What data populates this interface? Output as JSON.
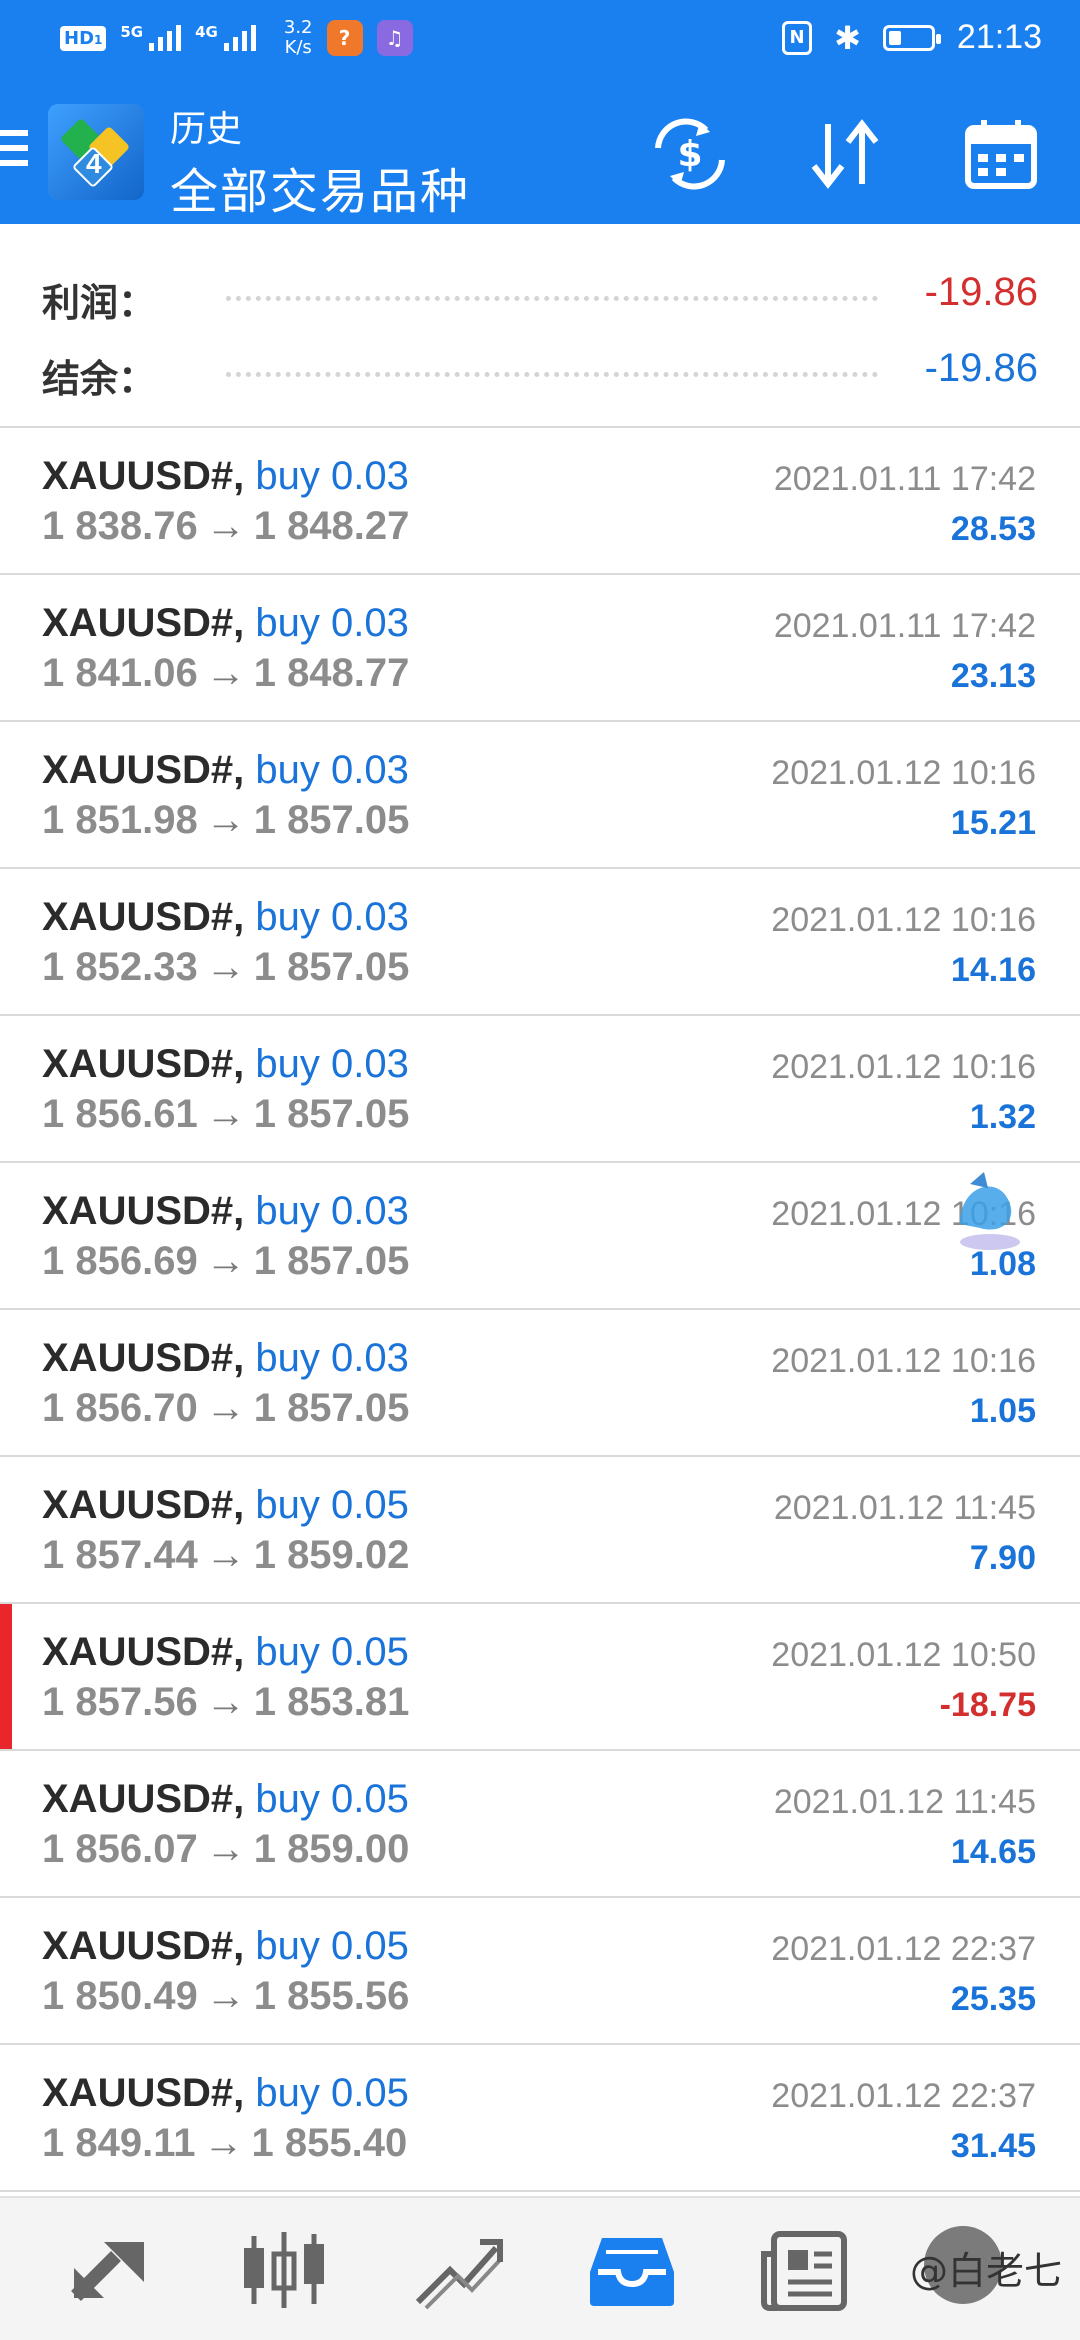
{
  "statusbar": {
    "hd_label": "HD",
    "hd_sub": "1",
    "sig1_label": "5G",
    "sig2_label": "4G",
    "speed_value": "3.2",
    "speed_unit": "K/s",
    "nfc_label": "N",
    "bluetooth_glyph": "✱",
    "battery_level": 0.3,
    "time": "21:13"
  },
  "appbar": {
    "subtitle": "历史",
    "title": "全部交易品种",
    "logo_number": "4"
  },
  "summary": {
    "profit_label": "利润：",
    "profit_value": "-19.86",
    "balance_label": "结余：",
    "balance_value": "-19.86"
  },
  "colors": {
    "accent": "#1a80f0",
    "positive": "#1a73d9",
    "negative": "#d32f2f"
  },
  "trades": [
    {
      "symbol": "XAUUSD#,",
      "action": "buy 0.03",
      "open": "1 838.76",
      "close": "1 848.27",
      "time": "2021.01.11 17:42",
      "profit": "28.53",
      "negative": false
    },
    {
      "symbol": "XAUUSD#,",
      "action": "buy 0.03",
      "open": "1 841.06",
      "close": "1 848.77",
      "time": "2021.01.11 17:42",
      "profit": "23.13",
      "negative": false
    },
    {
      "symbol": "XAUUSD#,",
      "action": "buy 0.03",
      "open": "1 851.98",
      "close": "1 857.05",
      "time": "2021.01.12 10:16",
      "profit": "15.21",
      "negative": false
    },
    {
      "symbol": "XAUUSD#,",
      "action": "buy 0.03",
      "open": "1 852.33",
      "close": "1 857.05",
      "time": "2021.01.12 10:16",
      "profit": "14.16",
      "negative": false
    },
    {
      "symbol": "XAUUSD#,",
      "action": "buy 0.03",
      "open": "1 856.61",
      "close": "1 857.05",
      "time": "2021.01.12 10:16",
      "profit": "1.32",
      "negative": false
    },
    {
      "symbol": "XAUUSD#,",
      "action": "buy 0.03",
      "open": "1 856.69",
      "close": "1 857.05",
      "time": "2021.01.12 10:16",
      "profit": "1.08",
      "negative": false
    },
    {
      "symbol": "XAUUSD#,",
      "action": "buy 0.03",
      "open": "1 856.70",
      "close": "1 857.05",
      "time": "2021.01.12 10:16",
      "profit": "1.05",
      "negative": false
    },
    {
      "symbol": "XAUUSD#,",
      "action": "buy 0.05",
      "open": "1 857.44",
      "close": "1 859.02",
      "time": "2021.01.12 11:45",
      "profit": "7.90",
      "negative": false
    },
    {
      "symbol": "XAUUSD#,",
      "action": "buy 0.05",
      "open": "1 857.56",
      "close": "1 853.81",
      "time": "2021.01.12 10:50",
      "profit": "-18.75",
      "negative": true
    },
    {
      "symbol": "XAUUSD#,",
      "action": "buy 0.05",
      "open": "1 856.07",
      "close": "1 859.00",
      "time": "2021.01.12 11:45",
      "profit": "14.65",
      "negative": false
    },
    {
      "symbol": "XAUUSD#,",
      "action": "buy 0.05",
      "open": "1 850.49",
      "close": "1 855.56",
      "time": "2021.01.12 22:37",
      "profit": "25.35",
      "negative": false
    },
    {
      "symbol": "XAUUSD#,",
      "action": "buy 0.05",
      "open": "1 849.11",
      "close": "1 855.40",
      "time": "2021.01.12 22:37",
      "profit": "31.45",
      "negative": false
    }
  ],
  "arrow_glyph": "→",
  "bottomnav": {
    "items": [
      {
        "icon": "quotes-arrows-icon",
        "active": false
      },
      {
        "icon": "candlestick-chart-icon",
        "active": false
      },
      {
        "icon": "trend-chart-icon",
        "active": false
      },
      {
        "icon": "history-inbox-icon",
        "active": true
      },
      {
        "icon": "news-icon",
        "active": false
      }
    ],
    "watermark": "@白老七"
  }
}
